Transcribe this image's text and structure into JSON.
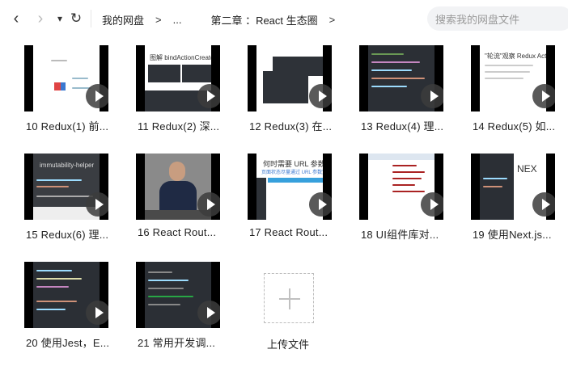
{
  "toolbar": {
    "back_icon": "‹",
    "forward_icon": "›",
    "dropdown_icon": "▾",
    "refresh_icon": "↻"
  },
  "breadcrumb": {
    "root": "我的网盘",
    "ellipsis": "...",
    "current": "第二章 ：React 生态圈",
    "separator": ">"
  },
  "search": {
    "placeholder": "搜索我的网盘文件"
  },
  "files": [
    {
      "label": "10  Redux(1)  前..."
    },
    {
      "label": "11  Redux(2)  深..."
    },
    {
      "label": "12  Redux(3)  在..."
    },
    {
      "label": "13  Redux(4)  理..."
    },
    {
      "label": "14  Redux(5)  如..."
    },
    {
      "label": "15  Redux(6)  理..."
    },
    {
      "label": "16  React Rout..."
    },
    {
      "label": "17  React Rout..."
    },
    {
      "label": "18  UI组件库对..."
    },
    {
      "label": "19  使用Next.js..."
    },
    {
      "label": "20  使用Jest，E..."
    },
    {
      "label": "21  常用开发调..."
    }
  ],
  "thumb_text": {
    "t11": "图解 bindActionCreators",
    "t14": "\"轮流\"观察 Redux Actio",
    "t15": "immutability-helper",
    "t17a": "何时需要 URL 参数",
    "t17b": "页面状态尽量通过 URL 参数定义",
    "t19": "NEX"
  },
  "upload": {
    "label": "上传文件"
  },
  "colors": {
    "accent_green": "#28a745",
    "play_bg": "#3c3c3c"
  }
}
